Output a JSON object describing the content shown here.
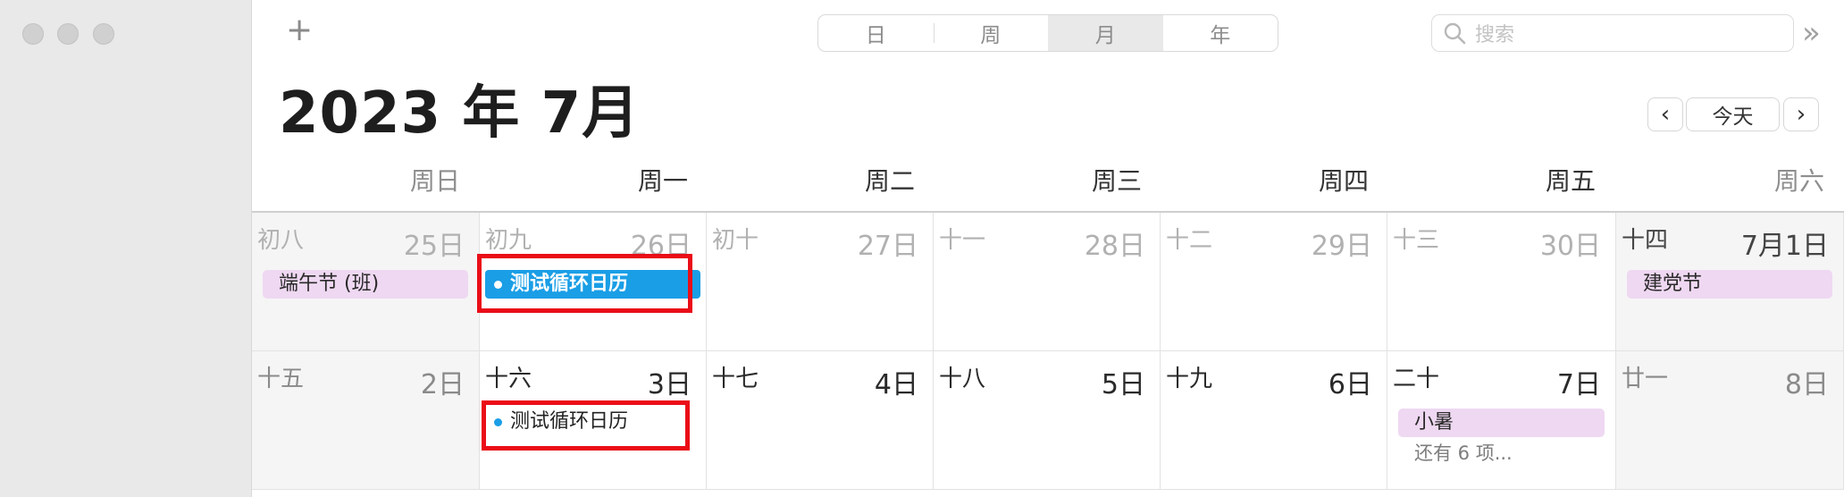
{
  "window": {
    "traffic_lights": [
      "close",
      "minimize",
      "zoom"
    ]
  },
  "toolbar": {
    "add_label": "+",
    "view_tabs": [
      {
        "label": "日",
        "active": false
      },
      {
        "label": "周",
        "active": false
      },
      {
        "label": "月",
        "active": true
      },
      {
        "label": "年",
        "active": false
      }
    ],
    "search_placeholder": "搜索",
    "more_label": "»"
  },
  "header": {
    "title": "2023 年 7月",
    "prev_label": "‹",
    "today_label": "今天",
    "next_label": "›"
  },
  "weekdays": [
    "周日",
    "周一",
    "周二",
    "周三",
    "周四",
    "周五",
    "周六"
  ],
  "weeks": [
    {
      "days": [
        {
          "lunar": "初八",
          "day": "25日",
          "dim": true,
          "weekend": true,
          "holiday": "端午节 (班)"
        },
        {
          "lunar": "初九",
          "day": "26日",
          "dim": true,
          "event_selected": "测试循环日历"
        },
        {
          "lunar": "初十",
          "day": "27日",
          "dim": true
        },
        {
          "lunar": "十一",
          "day": "28日",
          "dim": true
        },
        {
          "lunar": "十二",
          "day": "29日",
          "dim": true
        },
        {
          "lunar": "十三",
          "day": "30日",
          "dim": true
        },
        {
          "lunar": "十四",
          "day": "7月1日",
          "dim": false,
          "weekend": true,
          "holiday": "建党节"
        }
      ]
    },
    {
      "days": [
        {
          "lunar": "十五",
          "day": "2日",
          "weekend": true
        },
        {
          "lunar": "十六",
          "day": "3日",
          "event": "测试循环日历"
        },
        {
          "lunar": "十七",
          "day": "4日"
        },
        {
          "lunar": "十八",
          "day": "5日"
        },
        {
          "lunar": "十九",
          "day": "6日"
        },
        {
          "lunar": "二十",
          "day": "7日",
          "holiday": "小暑",
          "more": "还有 6 项..."
        },
        {
          "lunar": "廿一",
          "day": "8日",
          "weekend": true
        }
      ]
    }
  ],
  "colors": {
    "event_blue": "#1a9ee6",
    "holiday_bg": "#efd8f2",
    "highlight_red": "#ea0d17"
  }
}
